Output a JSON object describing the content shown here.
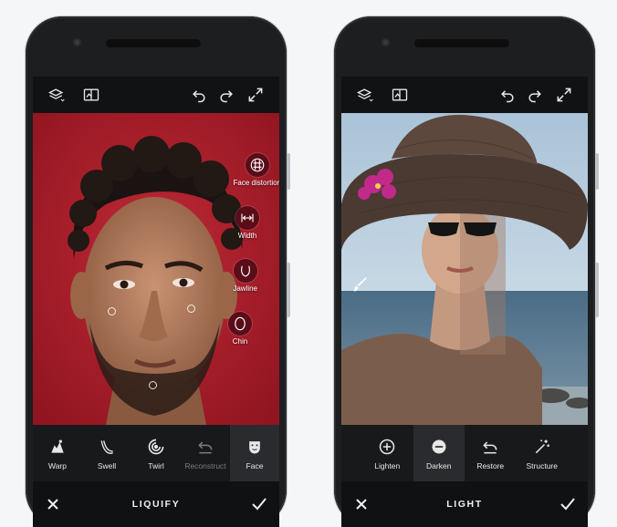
{
  "left_phone": {
    "bottom_title": "LIQUIFY",
    "face_tools": [
      {
        "label": "Face distortion",
        "icon": "grid-icon"
      },
      {
        "label": "Width",
        "icon": "width-arrows-icon"
      },
      {
        "label": "Jawline",
        "icon": "jawline-icon"
      },
      {
        "label": "Chin",
        "icon": "chin-icon"
      }
    ],
    "tools": [
      {
        "label": "Warp",
        "icon": "warp-icon"
      },
      {
        "label": "Swell",
        "icon": "swell-icon"
      },
      {
        "label": "Twirl",
        "icon": "twirl-icon"
      },
      {
        "label": "Reconstruct",
        "icon": "undo-arc-icon"
      },
      {
        "label": "Face",
        "icon": "face-icon"
      }
    ],
    "active_tool": "Face",
    "disabled_tool": "Reconstruct",
    "photo_background": "#b11f2c"
  },
  "right_phone": {
    "bottom_title": "LIGHT",
    "tools": [
      {
        "label": "Lighten",
        "icon": "plus-circle-icon"
      },
      {
        "label": "Darken",
        "icon": "minus-circle-icon"
      },
      {
        "label": "Restore",
        "icon": "undo-arc-icon"
      },
      {
        "label": "Structure",
        "icon": "magic-wand-icon"
      }
    ],
    "active_tool": "Darken"
  },
  "colors": {
    "phone_body": "#1d1e20",
    "toolbar": "#18191b",
    "accent_face_tool": "#5a0d18"
  }
}
